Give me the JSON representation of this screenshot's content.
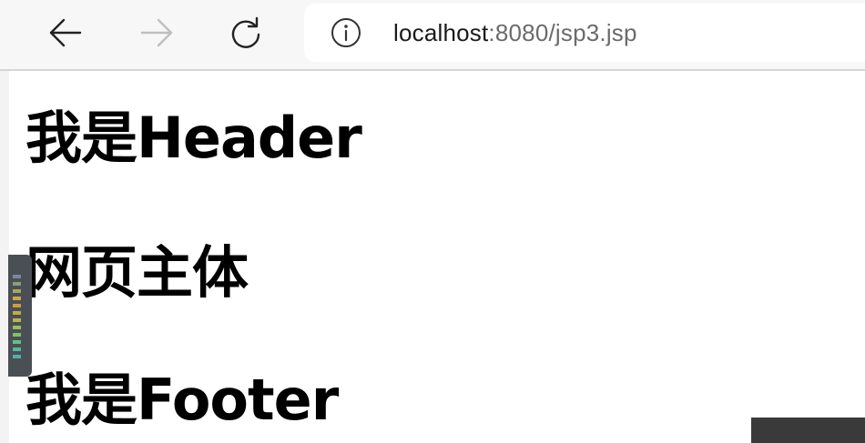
{
  "browser": {
    "url_host": "localhost",
    "url_rest": ":8080/jsp3.jsp",
    "icons": {
      "back": "arrow-left-icon",
      "forward": "arrow-right-icon",
      "reload": "reload-icon",
      "info": "info-icon"
    },
    "forward_enabled": false
  },
  "page": {
    "header_text": "我是Header",
    "main_text": "网页主体",
    "footer_text": "我是Footer"
  },
  "colors": {
    "text": "#000000",
    "url_host": "#1a1a1a",
    "url_rest": "#6b6b6b",
    "icon_active": "#222222",
    "icon_disabled": "#bfbfbf"
  }
}
